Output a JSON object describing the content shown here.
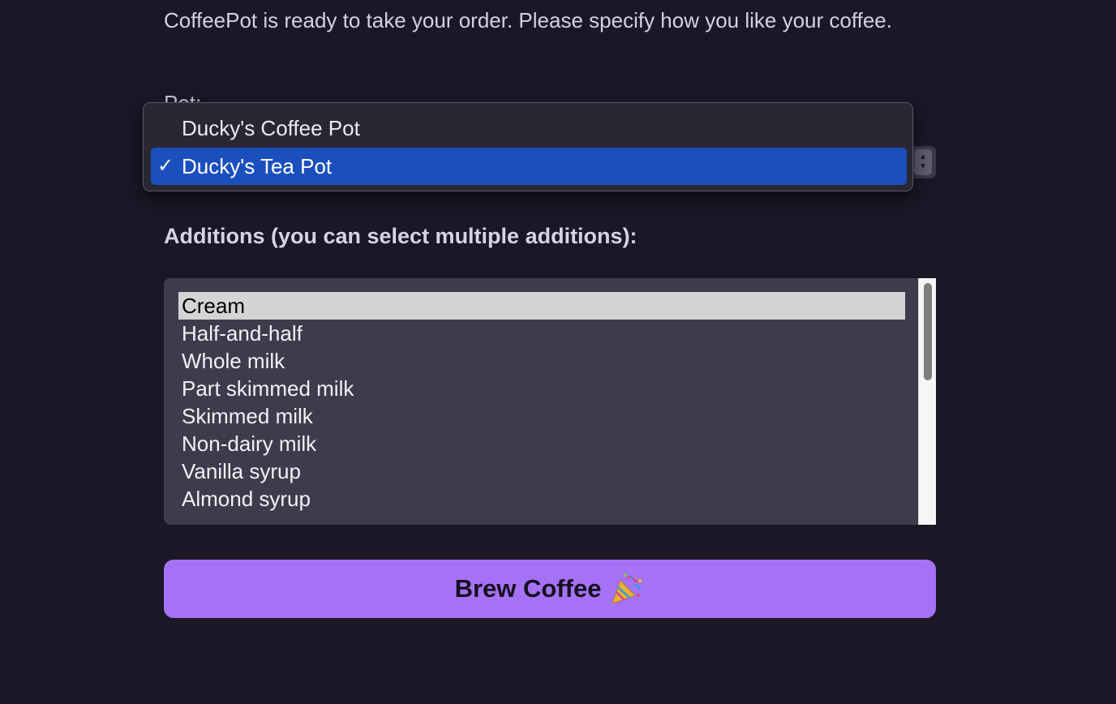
{
  "intro": {
    "text": "CoffeePot is ready to take your order. Please specify how you like your coffee."
  },
  "pot_select": {
    "label_partial": "Pot:",
    "options": [
      {
        "label": "Ducky's Coffee Pot",
        "selected": false
      },
      {
        "label": "Ducky's Tea Pot",
        "selected": true
      }
    ],
    "checkmark": "✓"
  },
  "additions": {
    "label": "Additions (you can select multiple additions):",
    "items": [
      {
        "label": "Cream",
        "selected": true
      },
      {
        "label": "Half-and-half",
        "selected": false
      },
      {
        "label": "Whole milk",
        "selected": false
      },
      {
        "label": "Part skimmed milk",
        "selected": false
      },
      {
        "label": "Skimmed milk",
        "selected": false
      },
      {
        "label": "Non-dairy milk",
        "selected": false
      },
      {
        "label": "Vanilla syrup",
        "selected": false
      },
      {
        "label": "Almond syrup",
        "selected": false
      }
    ]
  },
  "brew_button": {
    "label": "Brew Coffee",
    "icon": "party-popper-icon"
  },
  "colors": {
    "background": "#1b1727",
    "accent": "#a572f5",
    "selection_blue": "#1c4fbe"
  }
}
